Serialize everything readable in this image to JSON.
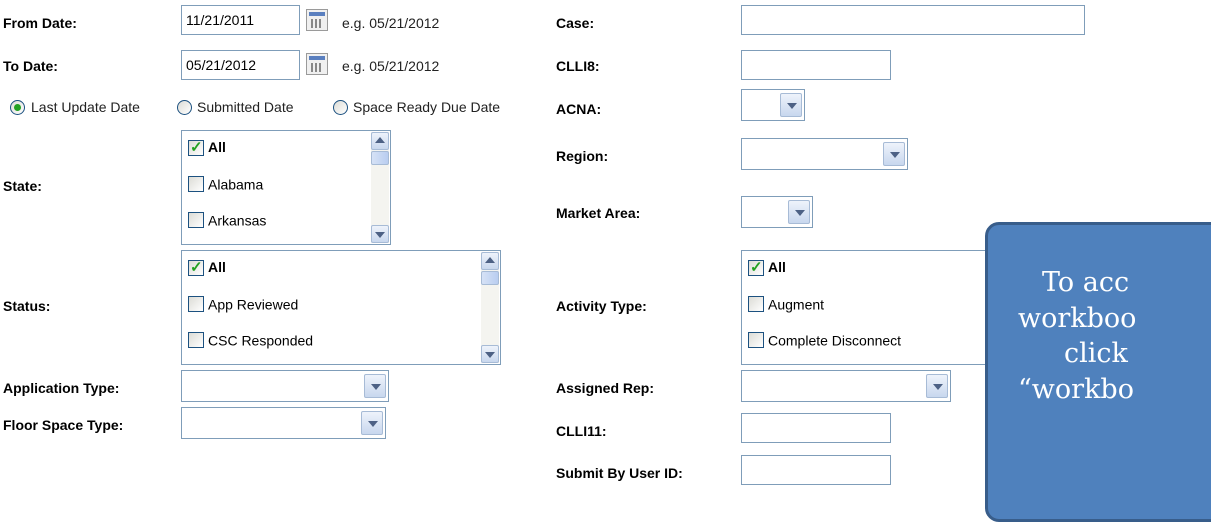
{
  "left": {
    "from_date": {
      "label": "From Date:",
      "value": "11/21/2011",
      "hint": "e.g. 05/21/2012"
    },
    "to_date": {
      "label": "To Date:",
      "value": "05/21/2012",
      "hint": "e.g. 05/21/2012"
    },
    "date_type": {
      "options": [
        "Last Update Date",
        "Submitted Date",
        "Space Ready Due Date"
      ],
      "selected": "Last Update Date"
    },
    "state": {
      "label": "State:",
      "items": [
        {
          "label": "All",
          "checked": true
        },
        {
          "label": "Alabama",
          "checked": false
        },
        {
          "label": "Arkansas",
          "checked": false
        }
      ]
    },
    "status": {
      "label": "Status:",
      "items": [
        {
          "label": "All",
          "checked": true
        },
        {
          "label": "App Reviewed",
          "checked": false
        },
        {
          "label": "CSC Responded",
          "checked": false
        }
      ]
    },
    "application_type": {
      "label": "Application Type:",
      "value": ""
    },
    "floor_space_type": {
      "label": "Floor Space Type:",
      "value": ""
    }
  },
  "right": {
    "case": {
      "label": "Case:",
      "value": ""
    },
    "clli8": {
      "label": "CLLI8:",
      "value": ""
    },
    "acna": {
      "label": "ACNA:",
      "value": ""
    },
    "region": {
      "label": "Region:",
      "value": ""
    },
    "market_area": {
      "label": "Market Area:",
      "value": ""
    },
    "activity_type": {
      "label": "Activity Type:",
      "items": [
        {
          "label": "All",
          "checked": true
        },
        {
          "label": "Augment",
          "checked": false
        },
        {
          "label": "Complete Disconnect",
          "checked": false
        }
      ]
    },
    "assigned_rep": {
      "label": "Assigned Rep:",
      "value": ""
    },
    "clli11": {
      "label": "CLLI11:",
      "value": ""
    },
    "submit_by_user_id": {
      "label": "Submit By User ID:",
      "value": ""
    }
  },
  "callout": {
    "lines": [
      "To acc",
      "workboo",
      "click",
      "“workbo"
    ],
    "color": "#4f81bd"
  }
}
